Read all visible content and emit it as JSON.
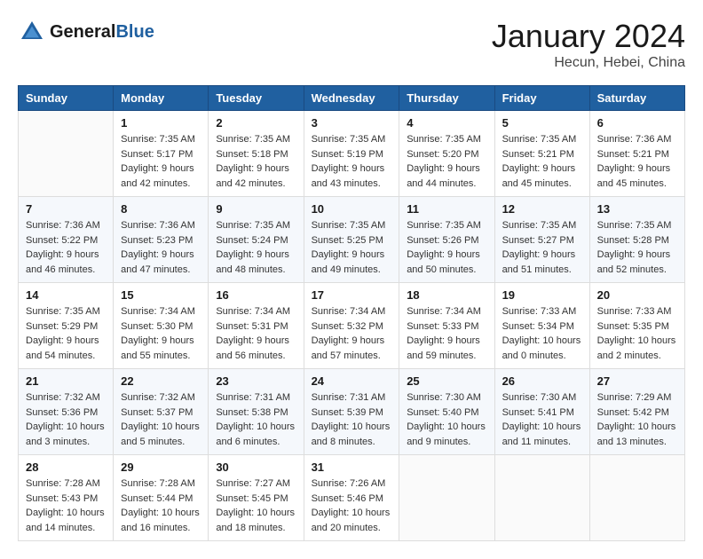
{
  "header": {
    "logo_text_general": "General",
    "logo_text_blue": "Blue",
    "month": "January 2024",
    "location": "Hecun, Hebei, China"
  },
  "weekdays": [
    "Sunday",
    "Monday",
    "Tuesday",
    "Wednesday",
    "Thursday",
    "Friday",
    "Saturday"
  ],
  "weeks": [
    [
      {
        "day": "",
        "sunrise": "",
        "sunset": "",
        "daylight": ""
      },
      {
        "day": "1",
        "sunrise": "Sunrise: 7:35 AM",
        "sunset": "Sunset: 5:17 PM",
        "daylight": "Daylight: 9 hours and 42 minutes."
      },
      {
        "day": "2",
        "sunrise": "Sunrise: 7:35 AM",
        "sunset": "Sunset: 5:18 PM",
        "daylight": "Daylight: 9 hours and 42 minutes."
      },
      {
        "day": "3",
        "sunrise": "Sunrise: 7:35 AM",
        "sunset": "Sunset: 5:19 PM",
        "daylight": "Daylight: 9 hours and 43 minutes."
      },
      {
        "day": "4",
        "sunrise": "Sunrise: 7:35 AM",
        "sunset": "Sunset: 5:20 PM",
        "daylight": "Daylight: 9 hours and 44 minutes."
      },
      {
        "day": "5",
        "sunrise": "Sunrise: 7:35 AM",
        "sunset": "Sunset: 5:21 PM",
        "daylight": "Daylight: 9 hours and 45 minutes."
      },
      {
        "day": "6",
        "sunrise": "Sunrise: 7:36 AM",
        "sunset": "Sunset: 5:21 PM",
        "daylight": "Daylight: 9 hours and 45 minutes."
      }
    ],
    [
      {
        "day": "7",
        "sunrise": "Sunrise: 7:36 AM",
        "sunset": "Sunset: 5:22 PM",
        "daylight": "Daylight: 9 hours and 46 minutes."
      },
      {
        "day": "8",
        "sunrise": "Sunrise: 7:36 AM",
        "sunset": "Sunset: 5:23 PM",
        "daylight": "Daylight: 9 hours and 47 minutes."
      },
      {
        "day": "9",
        "sunrise": "Sunrise: 7:35 AM",
        "sunset": "Sunset: 5:24 PM",
        "daylight": "Daylight: 9 hours and 48 minutes."
      },
      {
        "day": "10",
        "sunrise": "Sunrise: 7:35 AM",
        "sunset": "Sunset: 5:25 PM",
        "daylight": "Daylight: 9 hours and 49 minutes."
      },
      {
        "day": "11",
        "sunrise": "Sunrise: 7:35 AM",
        "sunset": "Sunset: 5:26 PM",
        "daylight": "Daylight: 9 hours and 50 minutes."
      },
      {
        "day": "12",
        "sunrise": "Sunrise: 7:35 AM",
        "sunset": "Sunset: 5:27 PM",
        "daylight": "Daylight: 9 hours and 51 minutes."
      },
      {
        "day": "13",
        "sunrise": "Sunrise: 7:35 AM",
        "sunset": "Sunset: 5:28 PM",
        "daylight": "Daylight: 9 hours and 52 minutes."
      }
    ],
    [
      {
        "day": "14",
        "sunrise": "Sunrise: 7:35 AM",
        "sunset": "Sunset: 5:29 PM",
        "daylight": "Daylight: 9 hours and 54 minutes."
      },
      {
        "day": "15",
        "sunrise": "Sunrise: 7:34 AM",
        "sunset": "Sunset: 5:30 PM",
        "daylight": "Daylight: 9 hours and 55 minutes."
      },
      {
        "day": "16",
        "sunrise": "Sunrise: 7:34 AM",
        "sunset": "Sunset: 5:31 PM",
        "daylight": "Daylight: 9 hours and 56 minutes."
      },
      {
        "day": "17",
        "sunrise": "Sunrise: 7:34 AM",
        "sunset": "Sunset: 5:32 PM",
        "daylight": "Daylight: 9 hours and 57 minutes."
      },
      {
        "day": "18",
        "sunrise": "Sunrise: 7:34 AM",
        "sunset": "Sunset: 5:33 PM",
        "daylight": "Daylight: 9 hours and 59 minutes."
      },
      {
        "day": "19",
        "sunrise": "Sunrise: 7:33 AM",
        "sunset": "Sunset: 5:34 PM",
        "daylight": "Daylight: 10 hours and 0 minutes."
      },
      {
        "day": "20",
        "sunrise": "Sunrise: 7:33 AM",
        "sunset": "Sunset: 5:35 PM",
        "daylight": "Daylight: 10 hours and 2 minutes."
      }
    ],
    [
      {
        "day": "21",
        "sunrise": "Sunrise: 7:32 AM",
        "sunset": "Sunset: 5:36 PM",
        "daylight": "Daylight: 10 hours and 3 minutes."
      },
      {
        "day": "22",
        "sunrise": "Sunrise: 7:32 AM",
        "sunset": "Sunset: 5:37 PM",
        "daylight": "Daylight: 10 hours and 5 minutes."
      },
      {
        "day": "23",
        "sunrise": "Sunrise: 7:31 AM",
        "sunset": "Sunset: 5:38 PM",
        "daylight": "Daylight: 10 hours and 6 minutes."
      },
      {
        "day": "24",
        "sunrise": "Sunrise: 7:31 AM",
        "sunset": "Sunset: 5:39 PM",
        "daylight": "Daylight: 10 hours and 8 minutes."
      },
      {
        "day": "25",
        "sunrise": "Sunrise: 7:30 AM",
        "sunset": "Sunset: 5:40 PM",
        "daylight": "Daylight: 10 hours and 9 minutes."
      },
      {
        "day": "26",
        "sunrise": "Sunrise: 7:30 AM",
        "sunset": "Sunset: 5:41 PM",
        "daylight": "Daylight: 10 hours and 11 minutes."
      },
      {
        "day": "27",
        "sunrise": "Sunrise: 7:29 AM",
        "sunset": "Sunset: 5:42 PM",
        "daylight": "Daylight: 10 hours and 13 minutes."
      }
    ],
    [
      {
        "day": "28",
        "sunrise": "Sunrise: 7:28 AM",
        "sunset": "Sunset: 5:43 PM",
        "daylight": "Daylight: 10 hours and 14 minutes."
      },
      {
        "day": "29",
        "sunrise": "Sunrise: 7:28 AM",
        "sunset": "Sunset: 5:44 PM",
        "daylight": "Daylight: 10 hours and 16 minutes."
      },
      {
        "day": "30",
        "sunrise": "Sunrise: 7:27 AM",
        "sunset": "Sunset: 5:45 PM",
        "daylight": "Daylight: 10 hours and 18 minutes."
      },
      {
        "day": "31",
        "sunrise": "Sunrise: 7:26 AM",
        "sunset": "Sunset: 5:46 PM",
        "daylight": "Daylight: 10 hours and 20 minutes."
      },
      {
        "day": "",
        "sunrise": "",
        "sunset": "",
        "daylight": ""
      },
      {
        "day": "",
        "sunrise": "",
        "sunset": "",
        "daylight": ""
      },
      {
        "day": "",
        "sunrise": "",
        "sunset": "",
        "daylight": ""
      }
    ]
  ]
}
